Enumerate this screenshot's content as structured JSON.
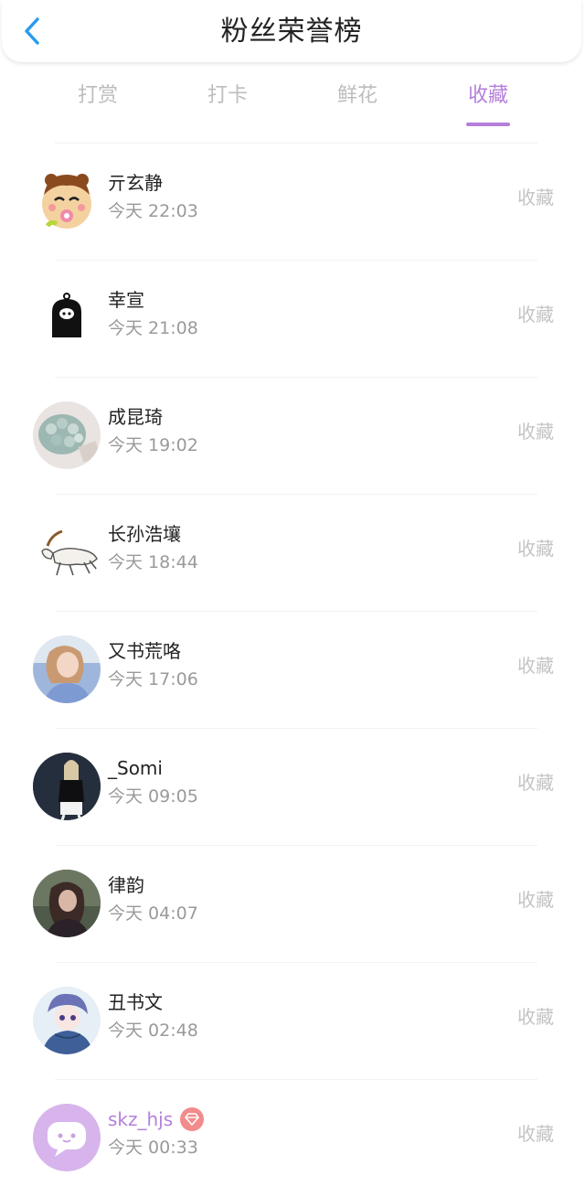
{
  "header": {
    "title": "粉丝荣誉榜",
    "back_icon": "chevron-left-icon",
    "back_color": "#2a9bef"
  },
  "tabs": [
    {
      "label": "打赏",
      "active": false
    },
    {
      "label": "打卡",
      "active": false
    },
    {
      "label": "鲜花",
      "active": false
    },
    {
      "label": "收藏",
      "active": true
    }
  ],
  "accent_color": "#b57fdb",
  "fans": [
    {
      "name": "亓玄静",
      "time": "今天 22:03",
      "action": "收藏",
      "avatar": "cartoon-baby-avatar"
    },
    {
      "name": "幸宣",
      "time": "今天 21:08",
      "action": "收藏",
      "avatar": "black-ghost-avatar"
    },
    {
      "name": "成昆琦",
      "time": "今天 19:02",
      "action": "收藏",
      "avatar": "flower-bouquet-avatar"
    },
    {
      "name": "长孙浩壤",
      "time": "今天 18:44",
      "action": "收藏",
      "avatar": "goat-drawing-avatar"
    },
    {
      "name": "又书荒咯",
      "time": "今天 17:06",
      "action": "收藏",
      "avatar": "girl-photo-avatar"
    },
    {
      "name": "_Somi",
      "time": "今天 09:05",
      "action": "收藏",
      "avatar": "stage-performer-avatar"
    },
    {
      "name": "律韵",
      "time": "今天 04:07",
      "action": "收藏",
      "avatar": "dark-portrait-avatar"
    },
    {
      "name": "丑书文",
      "time": "今天 02:48",
      "action": "收藏",
      "avatar": "anime-boy-avatar"
    },
    {
      "name": "skz_hjs",
      "time": "今天 00:33",
      "action": "收藏",
      "avatar": "chat-bubble-avatar",
      "vip": true,
      "badge_icon": "diamond-vip-icon"
    }
  ]
}
